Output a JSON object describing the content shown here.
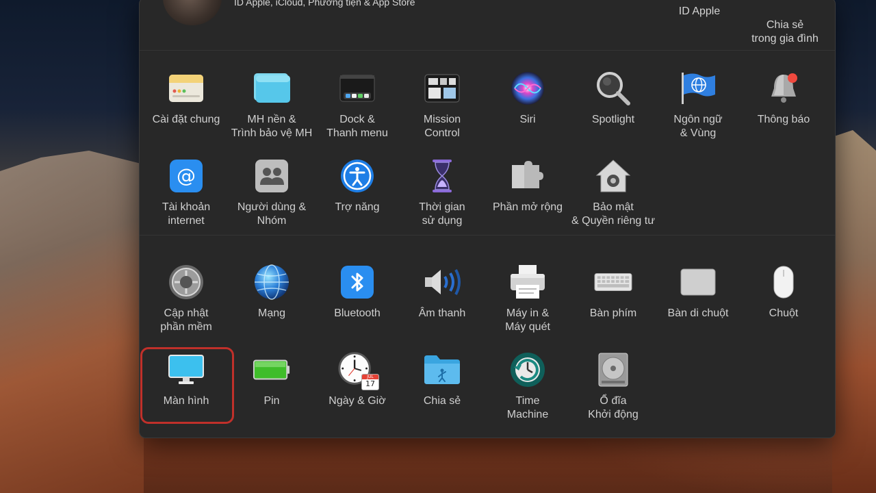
{
  "account": {
    "subtitle": "ID Apple, iCloud, Phương tiện & App Store",
    "apple_id_label": "ID Apple",
    "family_sharing_label": "Chia sẻ\ntrong gia đình"
  },
  "rows": {
    "row1": [
      {
        "label": "Cài đặt chung",
        "icon": "general-icon"
      },
      {
        "label": "MH nền &\nTrình bảo vệ MH",
        "icon": "desktop-screensaver-icon"
      },
      {
        "label": "Dock &\nThanh menu",
        "icon": "dock-icon"
      },
      {
        "label": "Mission\nControl",
        "icon": "mission-control-icon"
      },
      {
        "label": "Siri",
        "icon": "siri-icon"
      },
      {
        "label": "Spotlight",
        "icon": "spotlight-icon"
      },
      {
        "label": "Ngôn ngữ\n& Vùng",
        "icon": "language-region-icon"
      },
      {
        "label": "Thông báo",
        "icon": "notifications-icon"
      }
    ],
    "row2": [
      {
        "label": "Tài khoản\ninternet",
        "icon": "internet-accounts-icon"
      },
      {
        "label": "Người dùng &\nNhóm",
        "icon": "users-groups-icon"
      },
      {
        "label": "Trợ năng",
        "icon": "accessibility-icon"
      },
      {
        "label": "Thời gian\nsử dụng",
        "icon": "screen-time-icon"
      },
      {
        "label": "Phần mở rộng",
        "icon": "extensions-icon"
      },
      {
        "label": "Bảo mật\n& Quyền riêng tư",
        "icon": "security-privacy-icon"
      }
    ],
    "row3": [
      {
        "label": "Cập nhật\nphần mềm",
        "icon": "software-update-icon"
      },
      {
        "label": "Mạng",
        "icon": "network-icon"
      },
      {
        "label": "Bluetooth",
        "icon": "bluetooth-icon"
      },
      {
        "label": "Âm thanh",
        "icon": "sound-icon"
      },
      {
        "label": "Máy in &\nMáy quét",
        "icon": "printers-scanners-icon"
      },
      {
        "label": "Bàn phím",
        "icon": "keyboard-icon"
      },
      {
        "label": "Bàn di chuột",
        "icon": "trackpad-icon"
      },
      {
        "label": "Chuột",
        "icon": "mouse-icon"
      }
    ],
    "row4": [
      {
        "label": "Màn hình",
        "icon": "displays-icon"
      },
      {
        "label": "Pin",
        "icon": "battery-icon"
      },
      {
        "label": "Ngày & Giờ",
        "icon": "date-time-icon",
        "calendar_month": "JUL",
        "calendar_day": "17"
      },
      {
        "label": "Chia sẻ",
        "icon": "sharing-icon"
      },
      {
        "label": "Time\nMachine",
        "icon": "time-machine-icon"
      },
      {
        "label": "Ổ đĩa\nKhởi động",
        "icon": "startup-disk-icon"
      }
    ]
  },
  "colors": {
    "window_bg": "#282828",
    "label_text": "#d0d0d0",
    "highlight": "#c0302a"
  }
}
